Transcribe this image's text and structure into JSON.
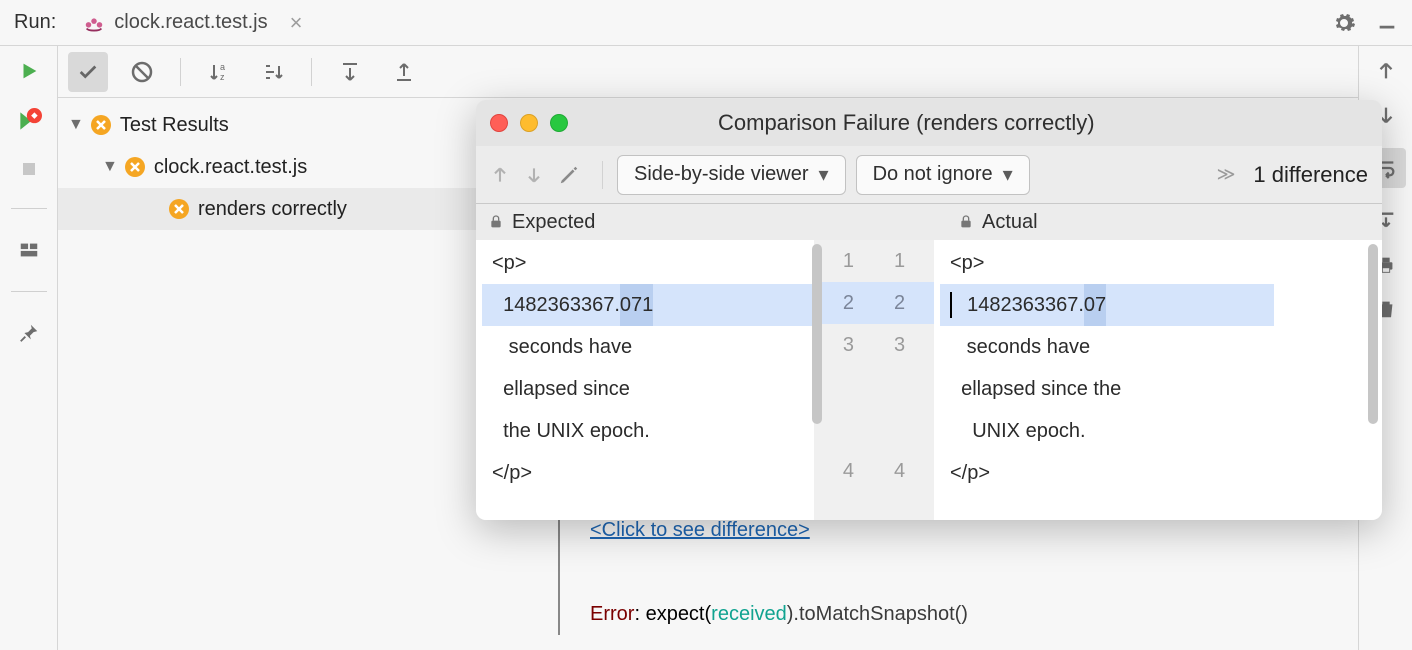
{
  "header": {
    "run_label": "Run:",
    "tab_file": "clock.react.test.js"
  },
  "tree": {
    "root": "Test Results",
    "file": "clock.react.test.js",
    "test": "renders correctly"
  },
  "console": {
    "click_link": "<Click to see difference>",
    "error_word": "Error",
    "error_rest": ": expect(",
    "received": "received",
    "error_tail": ").toMatchSnapshot()"
  },
  "dialog": {
    "title": "Comparison Failure (renders correctly)",
    "viewer_mode": "Side-by-side viewer",
    "ignore_mode": "Do not ignore",
    "diff_count": "1 difference",
    "expected_label": "Expected",
    "actual_label": "Actual",
    "expected": {
      "l1": "<p>",
      "l2_pre": "  1482363367.",
      "l2_diff": "071",
      "l3": "   seconds have",
      "l3b": "  ellapsed since",
      "l3c": "  the UNIX epoch.",
      "l4": "</p>"
    },
    "actual": {
      "l1": "<p>",
      "l2_pre": "  1482363367.",
      "l2_diff": "07",
      "l3": "   seconds have",
      "l3b": "  ellapsed since the",
      "l3c": "    UNIX epoch.",
      "l4": "</p>"
    },
    "lines": {
      "a1": "1",
      "a2": "2",
      "a3": "3",
      "a4": "4",
      "b1": "1",
      "b2": "2",
      "b3": "3",
      "b4": "4"
    }
  }
}
